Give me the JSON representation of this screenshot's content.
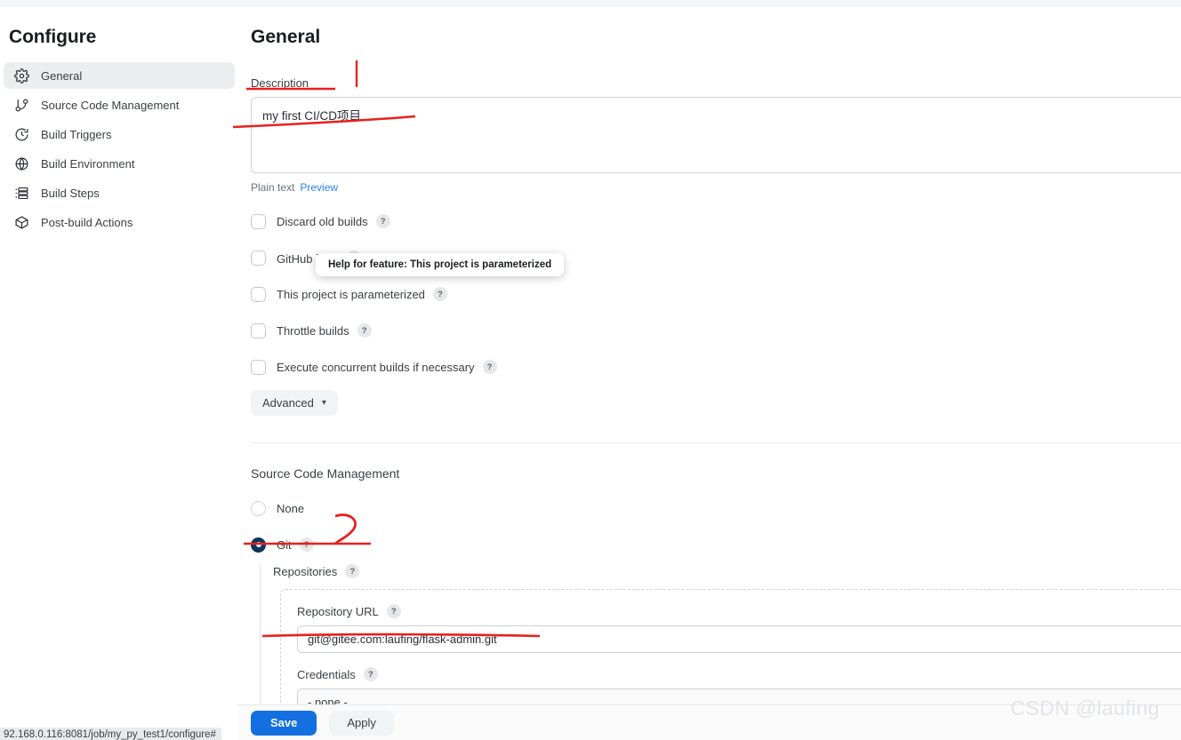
{
  "sidebar": {
    "title": "Configure",
    "items": [
      {
        "label": "General",
        "icon": "gear-icon",
        "active": true
      },
      {
        "label": "Source Code Management",
        "icon": "git-branch-icon",
        "active": false
      },
      {
        "label": "Build Triggers",
        "icon": "clock-icon",
        "active": false
      },
      {
        "label": "Build Environment",
        "icon": "globe-icon",
        "active": false
      },
      {
        "label": "Build Steps",
        "icon": "list-icon",
        "active": false
      },
      {
        "label": "Post-build Actions",
        "icon": "package-icon",
        "active": false
      }
    ]
  },
  "main": {
    "page_title": "General",
    "description": {
      "label": "Description",
      "value": "my first CI/CD项目",
      "mode_label": "Plain text",
      "preview_link": "Preview"
    },
    "checkboxes": [
      {
        "label": "Discard old builds",
        "help": "?",
        "checked": false
      },
      {
        "label": "GitHub 项目",
        "help": "?",
        "checked": false
      },
      {
        "label": "This project is parameterized",
        "help": "?",
        "checked": false
      },
      {
        "label": "Throttle builds",
        "help": "?",
        "checked": false
      },
      {
        "label": "Execute concurrent builds if necessary",
        "help": "?",
        "checked": false
      }
    ],
    "advanced_button": {
      "label": "Advanced",
      "chevron": "chevron-down-icon"
    },
    "scm": {
      "section_title": "Source Code Management",
      "options": [
        {
          "label": "None",
          "selected": false,
          "help": ""
        },
        {
          "label": "Git",
          "selected": true,
          "help": "?"
        }
      ],
      "repositories_label": "Repositories",
      "repositories_help": "?",
      "repository_url_label": "Repository URL",
      "repository_url_help": "?",
      "repository_url_value": "git@gitee.com:laufing/flask-admin.git",
      "credentials_label": "Credentials",
      "credentials_help": "?",
      "credentials_value": "- none -"
    }
  },
  "tooltip": {
    "text": "Help for feature: This project is parameterized"
  },
  "footer": {
    "save_label": "Save",
    "apply_label": "Apply"
  },
  "status_bar": {
    "url": "92.168.0.116:8081/job/my_py_test1/configure#"
  },
  "watermark": {
    "text": "CSDN @laufing"
  },
  "colors": {
    "accent_blue": "#1470e0",
    "radio_navy": "#10355c",
    "link_blue": "#2d7ff9",
    "annotation_red": "#e8201f",
    "active_nav_bg": "#ecedef"
  }
}
